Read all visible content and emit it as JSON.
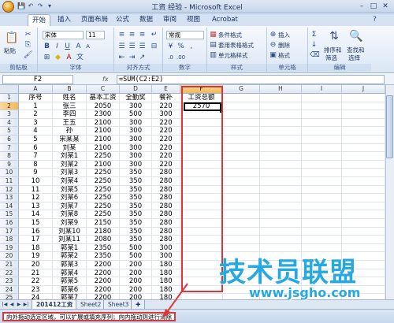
{
  "window": {
    "title": "工资 经验 - Microsoft Excel"
  },
  "ribbon_tabs": [
    "开始",
    "插入",
    "页面布局",
    "公式",
    "数据",
    "审阅",
    "视图",
    "Acrobat"
  ],
  "ribbon": {
    "clipboard": {
      "paste": "粘贴",
      "label": "剪贴板"
    },
    "font": {
      "name": "宋体",
      "size": "11",
      "bold": "B",
      "italic": "I",
      "underline": "U",
      "label": "字体"
    },
    "alignment": {
      "label": "对齐方式"
    },
    "number": {
      "format": "常规",
      "label": "数字"
    },
    "styles": {
      "conditional": "条件格式",
      "table": "套用表格格式",
      "cell": "单元格样式",
      "label": "样式"
    },
    "cells": {
      "insert": "插入",
      "delete": "删除",
      "format": "格式",
      "label": "单元格"
    },
    "editing": {
      "sort": "排序和",
      "sort2": "筛选",
      "find": "查找和",
      "find2": "选择",
      "label": "编辑"
    }
  },
  "formula_bar": {
    "name_box": "F2",
    "fx": "fx",
    "formula": "=SUM(C2:E2)"
  },
  "columns": [
    "A",
    "B",
    "C",
    "D",
    "E",
    "F",
    "G",
    "H",
    "I",
    "J"
  ],
  "header_row": [
    "序号",
    "姓名",
    "基本工资",
    "全勤奖",
    "餐补",
    "工资总额"
  ],
  "rows": [
    [
      "1",
      "张三",
      "2050",
      "300",
      "220",
      "2570"
    ],
    [
      "2",
      "李四",
      "2300",
      "500",
      "300",
      ""
    ],
    [
      "3",
      "王五",
      "2100",
      "300",
      "220",
      ""
    ],
    [
      "4",
      "孙",
      "2100",
      "300",
      "220",
      ""
    ],
    [
      "5",
      "宋某某",
      "2100",
      "300",
      "220",
      ""
    ],
    [
      "6",
      "刘某",
      "2100",
      "300",
      "220",
      ""
    ],
    [
      "7",
      "刘某1",
      "2250",
      "300",
      "220",
      ""
    ],
    [
      "8",
      "刘某2",
      "2100",
      "300",
      "220",
      ""
    ],
    [
      "9",
      "刘某3",
      "2250",
      "350",
      "280",
      ""
    ],
    [
      "10",
      "刘某4",
      "2250",
      "350",
      "280",
      ""
    ],
    [
      "11",
      "刘某5",
      "2250",
      "350",
      "280",
      ""
    ],
    [
      "12",
      "刘某6",
      "2250",
      "350",
      "280",
      ""
    ],
    [
      "13",
      "刘某7",
      "2250",
      "350",
      "280",
      ""
    ],
    [
      "14",
      "刘某8",
      "2250",
      "350",
      "280",
      ""
    ],
    [
      "15",
      "刘某9",
      "2150",
      "350",
      "280",
      ""
    ],
    [
      "16",
      "刘某10",
      "2180",
      "350",
      "280",
      ""
    ],
    [
      "17",
      "刘某11",
      "2080",
      "350",
      "280",
      ""
    ],
    [
      "18",
      "郭某1",
      "2350",
      "500",
      "300",
      ""
    ],
    [
      "19",
      "郭某2",
      "2350",
      "500",
      "300",
      ""
    ],
    [
      "20",
      "郭某3",
      "2200",
      "200",
      "180",
      ""
    ],
    [
      "21",
      "郭某4",
      "2200",
      "200",
      "180",
      ""
    ],
    [
      "22",
      "郭某5",
      "2200",
      "200",
      "180",
      ""
    ],
    [
      "23",
      "郭某6",
      "2200",
      "200",
      "180",
      ""
    ],
    [
      "24",
      "郭某7",
      "2200",
      "200",
      "180",
      ""
    ]
  ],
  "row_numbers": [
    "1",
    "2",
    "3",
    "4",
    "5",
    "6",
    "7",
    "8",
    "9",
    "10",
    "11",
    "12",
    "13",
    "14",
    "15",
    "16",
    "17",
    "18",
    "19",
    "20",
    "21",
    "22",
    "23",
    "24",
    "25"
  ],
  "sheets": [
    "201412工资",
    "Sheet2",
    "Sheet3"
  ],
  "status": "向外拖动选定区域，可以扩展或填充序列；向内拖动则进行清除",
  "watermark": {
    "main": "技术员联盟",
    "url": "www.jsgho.com"
  }
}
